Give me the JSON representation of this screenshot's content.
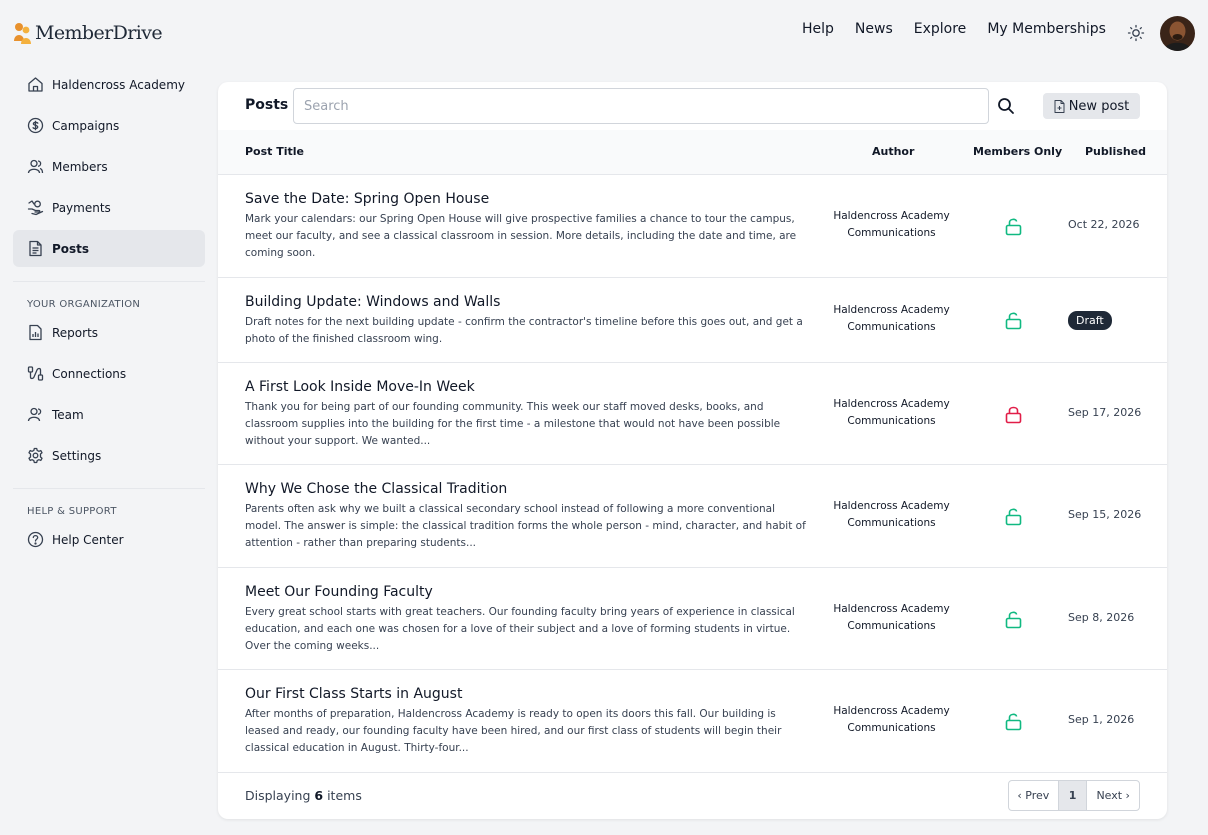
{
  "brand": {
    "name": "MemberDrive",
    "accent": "#e8912d"
  },
  "topnav": [
    "Help",
    "News",
    "Explore",
    "My Memberships"
  ],
  "sidebar": {
    "items": [
      {
        "label": "Haldencross Academy",
        "icon": "home-icon"
      },
      {
        "label": "Campaigns",
        "icon": "dollar-circle-icon"
      },
      {
        "label": "Members",
        "icon": "users-icon"
      },
      {
        "label": "Payments",
        "icon": "payment-hand-icon"
      },
      {
        "label": "Posts",
        "icon": "document-icon",
        "active": true
      }
    ],
    "org_section": "YOUR ORGANIZATION",
    "org_items": [
      {
        "label": "Reports",
        "icon": "report-icon"
      },
      {
        "label": "Connections",
        "icon": "connections-icon"
      },
      {
        "label": "Team",
        "icon": "team-icon"
      },
      {
        "label": "Settings",
        "icon": "gear-icon"
      }
    ],
    "help_section": "HELP & SUPPORT",
    "help_items": [
      {
        "label": "Help Center",
        "icon": "question-circle-icon"
      }
    ]
  },
  "posts": {
    "title": "Posts",
    "search_placeholder": "Search",
    "new_post_label": "New post",
    "columns": {
      "title": "Post Title",
      "author": "Author",
      "members_only": "Members Only",
      "published": "Published"
    },
    "rows": [
      {
        "title": "Save the Date: Spring Open House",
        "excerpt": "Mark your calendars: our Spring Open House will give prospective families a chance to tour the campus, meet our faculty, and see a classical classroom in session. More details, including the date and time, are coming soon.",
        "author": "Haldencross Academy Communications",
        "members_only": false,
        "published": "Oct 22, 2026"
      },
      {
        "title": "Building Update: Windows and Walls",
        "excerpt": "Draft notes for the next building update - confirm the contractor's timeline before this goes out, and get a photo of the finished classroom wing.",
        "author": "Haldencross Academy Communications",
        "members_only": false,
        "published": "Draft"
      },
      {
        "title": "A First Look Inside Move-In Week",
        "excerpt": "Thank you for being part of our founding community. This week our staff moved desks, books, and classroom supplies into the building for the first time - a milestone that would not have been possible without your support. We wanted...",
        "author": "Haldencross Academy Communications",
        "members_only": true,
        "published": "Sep 17, 2026"
      },
      {
        "title": "Why We Chose the Classical Tradition",
        "excerpt": "Parents often ask why we built a classical secondary school instead of following a more conventional model. The answer is simple: the classical tradition forms the whole person - mind, character, and habit of attention - rather than preparing students...",
        "author": "Haldencross Academy Communications",
        "members_only": false,
        "published": "Sep 15, 2026"
      },
      {
        "title": "Meet Our Founding Faculty",
        "excerpt": "Every great school starts with great teachers. Our founding faculty bring years of experience in classical education, and each one was chosen for a love of their subject and a love of forming students in virtue. Over the coming weeks...",
        "author": "Haldencross Academy Communications",
        "members_only": false,
        "published": "Sep 8, 2026"
      },
      {
        "title": "Our First Class Starts in August",
        "excerpt": "After months of preparation, Haldencross Academy is ready to open its doors this fall. Our building is leased and ready, our founding faculty have been hired, and our first class of students will begin their classical education in August. Thirty-four...",
        "author": "Haldencross Academy Communications",
        "members_only": false,
        "published": "Sep 1, 2026"
      }
    ],
    "footer": {
      "prefix": "Displaying",
      "count": "6",
      "suffix": "items"
    },
    "pager": {
      "prev": "‹ Prev",
      "current": "1",
      "next": "Next ›"
    }
  },
  "colors": {
    "unlocked": "#10b981",
    "locked": "#e11d48",
    "draft_badge": "#1f2937"
  }
}
